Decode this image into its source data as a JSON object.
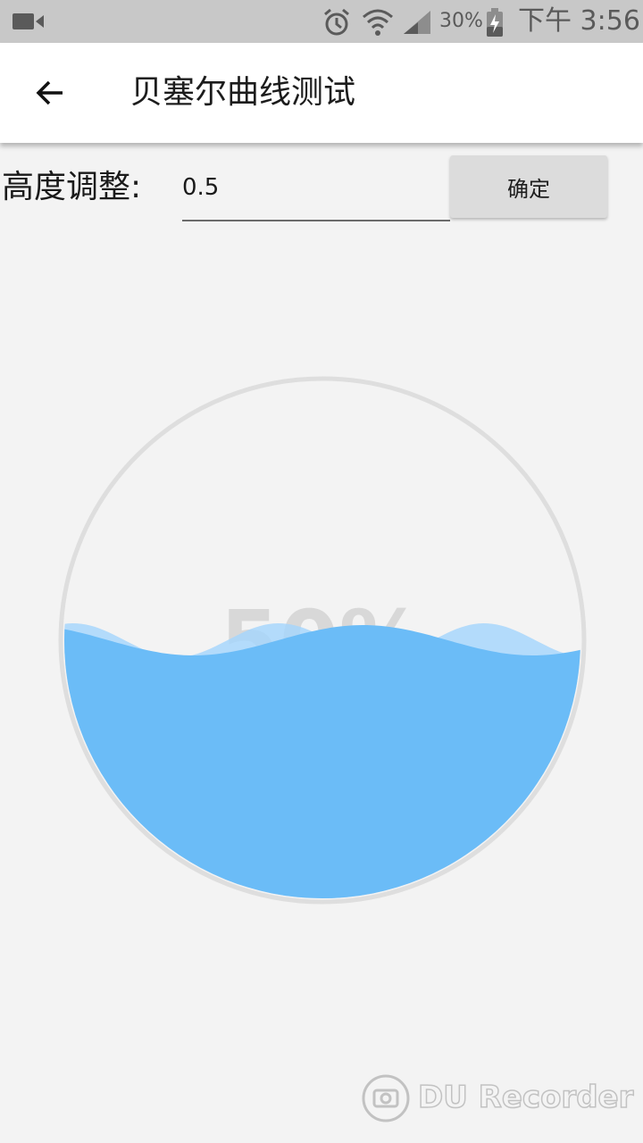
{
  "status_bar": {
    "battery_percent": "30%",
    "time": "下午 3:56",
    "icons": [
      "video-recorder-icon",
      "alarm-clock-icon",
      "wifi-icon",
      "cell-signal-icon",
      "battery-charging-icon"
    ]
  },
  "app_bar": {
    "back_icon": "arrow-left-icon",
    "title": "贝塞尔曲线测试"
  },
  "controls": {
    "height_label": "高度调整:",
    "height_value": "0.5",
    "confirm_label": "确定"
  },
  "wave_gauge": {
    "fill_level": 0.5,
    "percent_text": "50%",
    "colors": {
      "front_wave": "#6bbcf7",
      "back_wave": "#a7d6fb",
      "ring": "#dedede",
      "percent_text": "#b9b9b9"
    }
  },
  "watermark": {
    "icon": "screen-recorder-logo-icon",
    "text": "DU Recorder"
  }
}
